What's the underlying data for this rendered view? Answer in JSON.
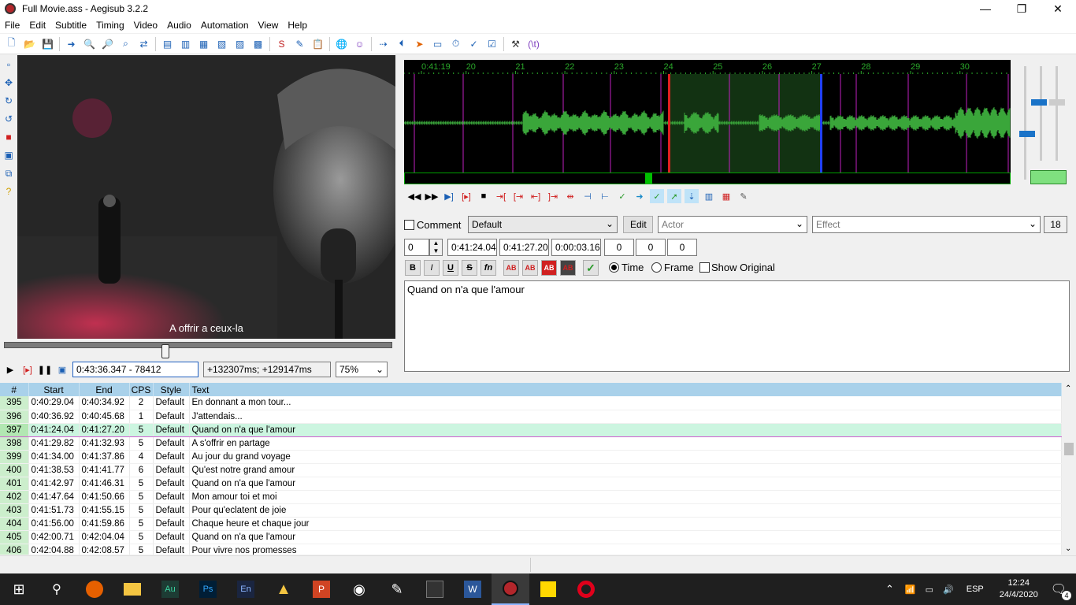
{
  "window": {
    "title": "Full Movie.ass - Aegisub 3.2.2"
  },
  "menu": [
    "File",
    "Edit",
    "Subtitle",
    "Timing",
    "Video",
    "Audio",
    "Automation",
    "View",
    "Help"
  ],
  "video": {
    "subtitle_text": "A offrir a ceux-la",
    "position": "0:43:36.347 - 78412",
    "offset": "+132307ms; +129147ms",
    "zoom": "75%"
  },
  "audio": {
    "ruler_labels": [
      "0:41:19",
      "20",
      "21",
      "22",
      "23",
      "24",
      "25",
      "26",
      "27",
      "28",
      "29",
      "30"
    ],
    "selection_start_color": "#e02020",
    "selection_end_color": "#2040ff",
    "waveform_color": "#3aa63a"
  },
  "edit": {
    "comment_label": "Comment",
    "style": "Default",
    "edit_button": "Edit",
    "actor_placeholder": "Actor",
    "effect_placeholder": "Effect",
    "char_count": "18",
    "layer": "0",
    "start": "0:41:24.04",
    "end": "0:41:27.20",
    "duration": "0:00:03.16",
    "margin_l": "0",
    "margin_r": "0",
    "margin_v": "0",
    "fmt": {
      "bold": "B",
      "italic": "I",
      "underline": "U",
      "strike": "S",
      "font": "fn",
      "c1": "AB",
      "c2": "AB",
      "c3": "AB",
      "c4": "AB"
    },
    "time_label": "Time",
    "frame_label": "Frame",
    "show_original_label": "Show Original",
    "text": "Quand on n'a que l'amour"
  },
  "grid": {
    "headers": [
      "#",
      "Start",
      "End",
      "CPS",
      "Style",
      "Text"
    ],
    "rows": [
      {
        "n": "395",
        "start": "0:40:29.04",
        "end": "0:40:34.92",
        "cps": "2",
        "style": "Default",
        "text": "En donnant a mon tour..."
      },
      {
        "n": "396",
        "start": "0:40:36.92",
        "end": "0:40:45.68",
        "cps": "1",
        "style": "Default",
        "text": "J'attendais..."
      },
      {
        "n": "397",
        "start": "0:41:24.04",
        "end": "0:41:27.20",
        "cps": "5",
        "style": "Default",
        "text": "Quand on n'a que l'amour"
      },
      {
        "n": "398",
        "start": "0:41:29.82",
        "end": "0:41:32.93",
        "cps": "5",
        "style": "Default",
        "text": "A s'offrir en partage"
      },
      {
        "n": "399",
        "start": "0:41:34.00",
        "end": "0:41:37.86",
        "cps": "4",
        "style": "Default",
        "text": "Au jour du grand voyage"
      },
      {
        "n": "400",
        "start": "0:41:38.53",
        "end": "0:41:41.77",
        "cps": "6",
        "style": "Default",
        "text": "Qu'est notre grand amour"
      },
      {
        "n": "401",
        "start": "0:41:42.97",
        "end": "0:41:46.31",
        "cps": "5",
        "style": "Default",
        "text": "Quand on n'a que l'amour"
      },
      {
        "n": "402",
        "start": "0:41:47.64",
        "end": "0:41:50.66",
        "cps": "5",
        "style": "Default",
        "text": "Mon amour toi et moi"
      },
      {
        "n": "403",
        "start": "0:41:51.73",
        "end": "0:41:55.15",
        "cps": "5",
        "style": "Default",
        "text": "Pour qu'eclatent de joie"
      },
      {
        "n": "404",
        "start": "0:41:56.00",
        "end": "0:41:59.86",
        "cps": "5",
        "style": "Default",
        "text": "Chaque heure et chaque jour"
      },
      {
        "n": "405",
        "start": "0:42:00.71",
        "end": "0:42:04.04",
        "cps": "5",
        "style": "Default",
        "text": "Quand on n'a que l'amour"
      },
      {
        "n": "406",
        "start": "0:42:04.88",
        "end": "0:42:08.57",
        "cps": "5",
        "style": "Default",
        "text": "Pour vivre nos promesses"
      }
    ]
  },
  "taskbar": {
    "apps": [
      "Au",
      "Ps",
      "En"
    ],
    "lang": "ESP",
    "time": "12:24",
    "date": "24/4/2020",
    "notifications": "4"
  }
}
